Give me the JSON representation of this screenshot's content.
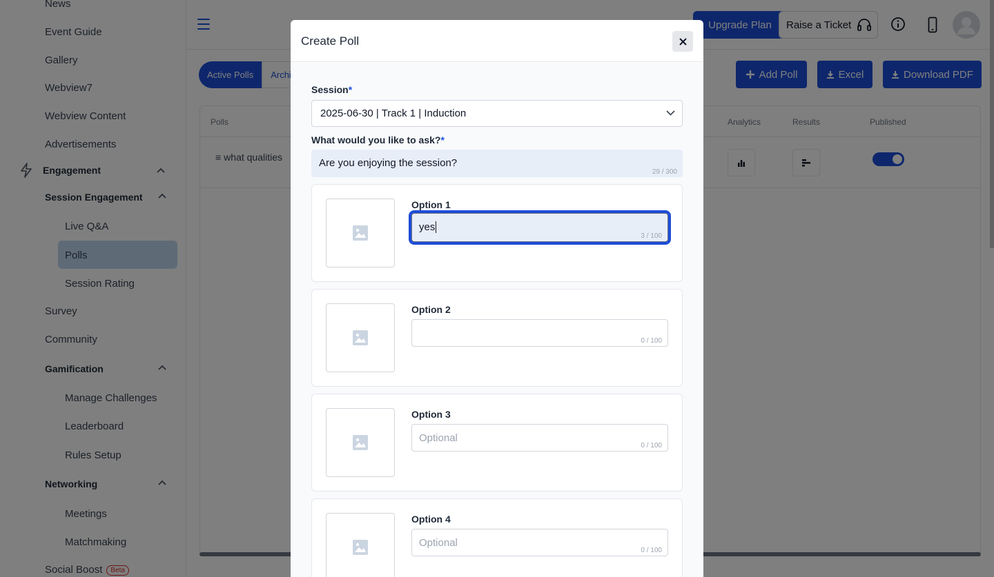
{
  "sidebar": {
    "items": [
      {
        "label": "News"
      },
      {
        "label": "Event Guide"
      },
      {
        "label": "Gallery"
      },
      {
        "label": "Webview7"
      },
      {
        "label": "Webview Content"
      },
      {
        "label": "Advertisements"
      },
      {
        "label": "Engagement"
      },
      {
        "label": "Session Engagement"
      },
      {
        "label": "Live Q&A"
      },
      {
        "label": "Polls"
      },
      {
        "label": "Session Rating"
      },
      {
        "label": "Survey"
      },
      {
        "label": "Community"
      },
      {
        "label": "Gamification"
      },
      {
        "label": "Manage Challenges"
      },
      {
        "label": "Leaderboard"
      },
      {
        "label": "Rules Setup"
      },
      {
        "label": "Networking"
      },
      {
        "label": "Meetings"
      },
      {
        "label": "Matchmaking"
      },
      {
        "label": "Social Boost"
      }
    ],
    "beta_badge": "Beta",
    "active_item": "Polls"
  },
  "topbar": {
    "upgrade_label": "Upgrade Plan",
    "ticket_label": "Raise a Ticket"
  },
  "tabs": [
    {
      "label": "Active Polls"
    },
    {
      "label": "Archi"
    }
  ],
  "actions": {
    "add_poll": "Add Poll",
    "excel": "Excel",
    "download_pdf": "Download PDF"
  },
  "table": {
    "headers": [
      "Polls",
      "Analytics",
      "Results",
      "Published"
    ],
    "rows": [
      {
        "poll": "what qualities",
        "published": true
      }
    ]
  },
  "modal": {
    "title": "Create Poll",
    "session_label": "Session",
    "session_value": "2025-06-30 | Track 1 | Induction",
    "question_label": "What would you like to ask?",
    "question_value": "Are you enjoying the session?",
    "question_counter": "29 / 300",
    "options": [
      {
        "label": "Option 1",
        "value": "yes",
        "placeholder": "",
        "counter": "3 / 100"
      },
      {
        "label": "Option 2",
        "value": "",
        "placeholder": "",
        "counter": "0 / 100"
      },
      {
        "label": "Option 3",
        "value": "",
        "placeholder": "Optional",
        "counter": "0 / 100"
      },
      {
        "label": "Option 4",
        "value": "",
        "placeholder": "Optional",
        "counter": "0 / 100"
      }
    ]
  },
  "colors": {
    "primary": "#1d4ed8",
    "active_nav_bg": "#bcd7ef",
    "beta": "#dc2626"
  }
}
